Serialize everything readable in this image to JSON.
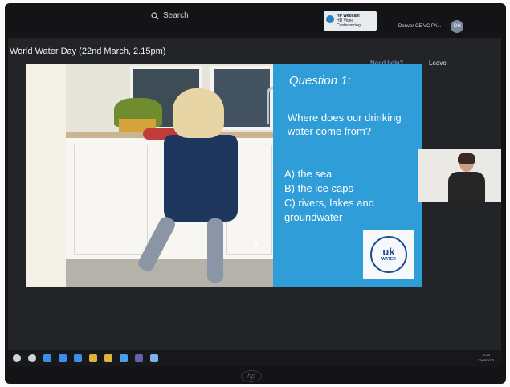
{
  "webcam_sticker": {
    "line1": "HP Webcam",
    "line2": "HD Video Conferencing"
  },
  "search": {
    "label": "Search"
  },
  "header": {
    "more_label": "···",
    "account_name": "Denver CE VC Pri...",
    "avatar_initials": "DH"
  },
  "meeting": {
    "title": "World Water Day (22nd March, 2.15pm)",
    "help_label": "Need help?",
    "leave_label": "Leave"
  },
  "slide": {
    "question_title": "Question 1:",
    "question_text": "Where does our drinking water come from?",
    "options": [
      "A) the sea",
      "B) the ice caps",
      "C) rivers, lakes and",
      "groundwater"
    ],
    "logo_text": "uk",
    "logo_sub": "WATER"
  },
  "taskbar": {
    "icons": [
      "windows-icon",
      "cortana-icon",
      "edge-icon",
      "store-icon",
      "files-icon",
      "chrome-icon",
      "folder-icon",
      "app-icon",
      "teams-icon",
      "paint-icon"
    ],
    "clock_time": "15:13",
    "clock_date": "22/03/2022"
  },
  "device": {
    "brand": "hp"
  },
  "colors": {
    "panel_blue": "#2f9dd8",
    "help_blue": "#7aa6e6",
    "logo_navy": "#1d4f8f"
  }
}
